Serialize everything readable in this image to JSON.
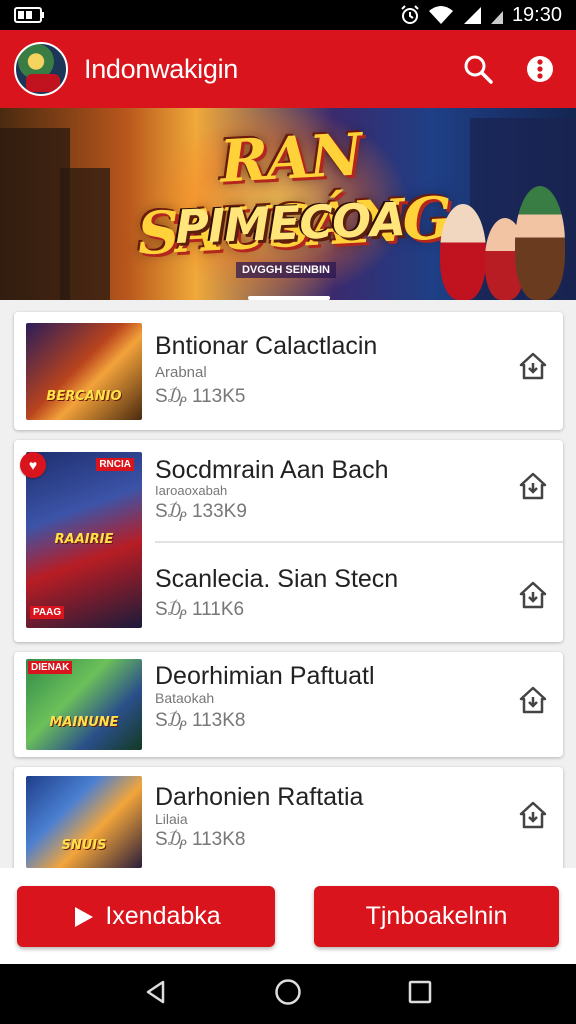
{
  "status": {
    "time": "19:30"
  },
  "app_bar": {
    "title": "Indonwakigin"
  },
  "hero": {
    "title_line1": "RAN SAUSÁNG",
    "title_line2": "PIMECOA",
    "tagline": "DVGGH SEINBIN"
  },
  "items": [
    {
      "title": "Bntionar Calactlacin",
      "subtitle": "Arabnal",
      "meta": "S₯ 113K5",
      "thumb_label": "BERCANIO"
    },
    {
      "title": "Socdmrain Aan Bach",
      "subtitle": "Iaroaoxabah",
      "meta": "S₯ 133K9",
      "thumb_label": "RAAIRIE"
    },
    {
      "title": "Scanlecia. Sian Stecn",
      "subtitle": "",
      "meta": "S₯ 111K6",
      "thumb_label": ""
    },
    {
      "title": "Deorhimian Paftuatl",
      "subtitle": "Bataokah",
      "meta": "S₯ 113K8",
      "thumb_label": "MAINUNE"
    },
    {
      "title": "Darhonien Raftatia",
      "subtitle": "Lilaia",
      "meta": "S₯ 113K8",
      "thumb_label": "SNUIS"
    }
  ],
  "badges": {
    "tall_thumb_top": "RNCIA",
    "tall_thumb_bottom": "PAAG",
    "item4_badge": "DIENAK"
  },
  "bottom_buttons": {
    "left_label": "Ixendabka",
    "right_label": "Tjnboakelnin"
  },
  "colors": {
    "brand_red": "#d9141c",
    "hero_gold": "#ffd23a"
  },
  "icons": [
    "battery-icon",
    "alarm-icon",
    "wifi-icon",
    "signal-icon",
    "search-icon",
    "more-menu-icon",
    "install-icon",
    "play-icon",
    "back-nav-icon",
    "home-nav-icon",
    "recents-nav-icon"
  ]
}
